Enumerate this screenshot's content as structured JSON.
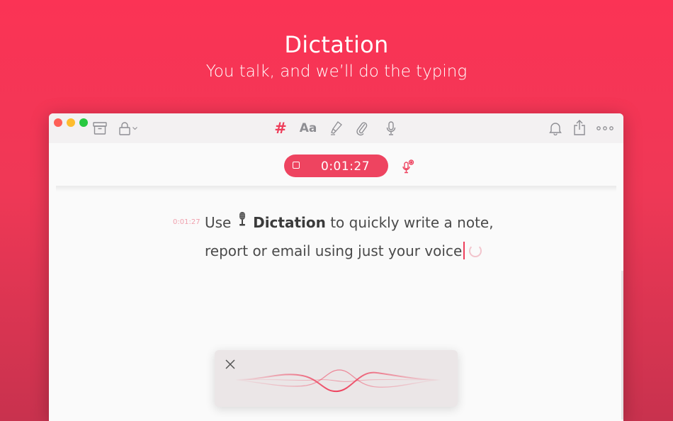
{
  "hero": {
    "title": "Dictation",
    "subtitle": "You talk, and we’ll do the typing"
  },
  "toolbar": {
    "left_icons": [
      "archive-icon",
      "lock-icon",
      "chevron-down-icon"
    ],
    "center_icons": [
      "hashtag-icon",
      "text-format-icon",
      "highlighter-icon",
      "paperclip-icon",
      "microphone-icon"
    ],
    "right_icons": [
      "bell-icon",
      "share-icon",
      "more-icon"
    ],
    "hash_glyph": "#",
    "format_glyph": "Aa"
  },
  "recording": {
    "elapsed": "0:01:27",
    "stop_icon": "stop-icon",
    "settings_icon": "microphone-settings-icon"
  },
  "note": {
    "timestamp": "0:01:27",
    "word_1": "Use",
    "emoji": "studio-microphone",
    "bold": "Dictation",
    "rest_1": "to quickly write a note,",
    "line_2": "report or email using just your voice"
  },
  "dictation_panel": {
    "close_icon": "close-icon",
    "waveform": "waveform"
  },
  "colors": {
    "accent": "#ee3e5a",
    "background_top": "#fb3355",
    "background_bottom": "#c8324e",
    "recording_bar": "#ee4460"
  }
}
